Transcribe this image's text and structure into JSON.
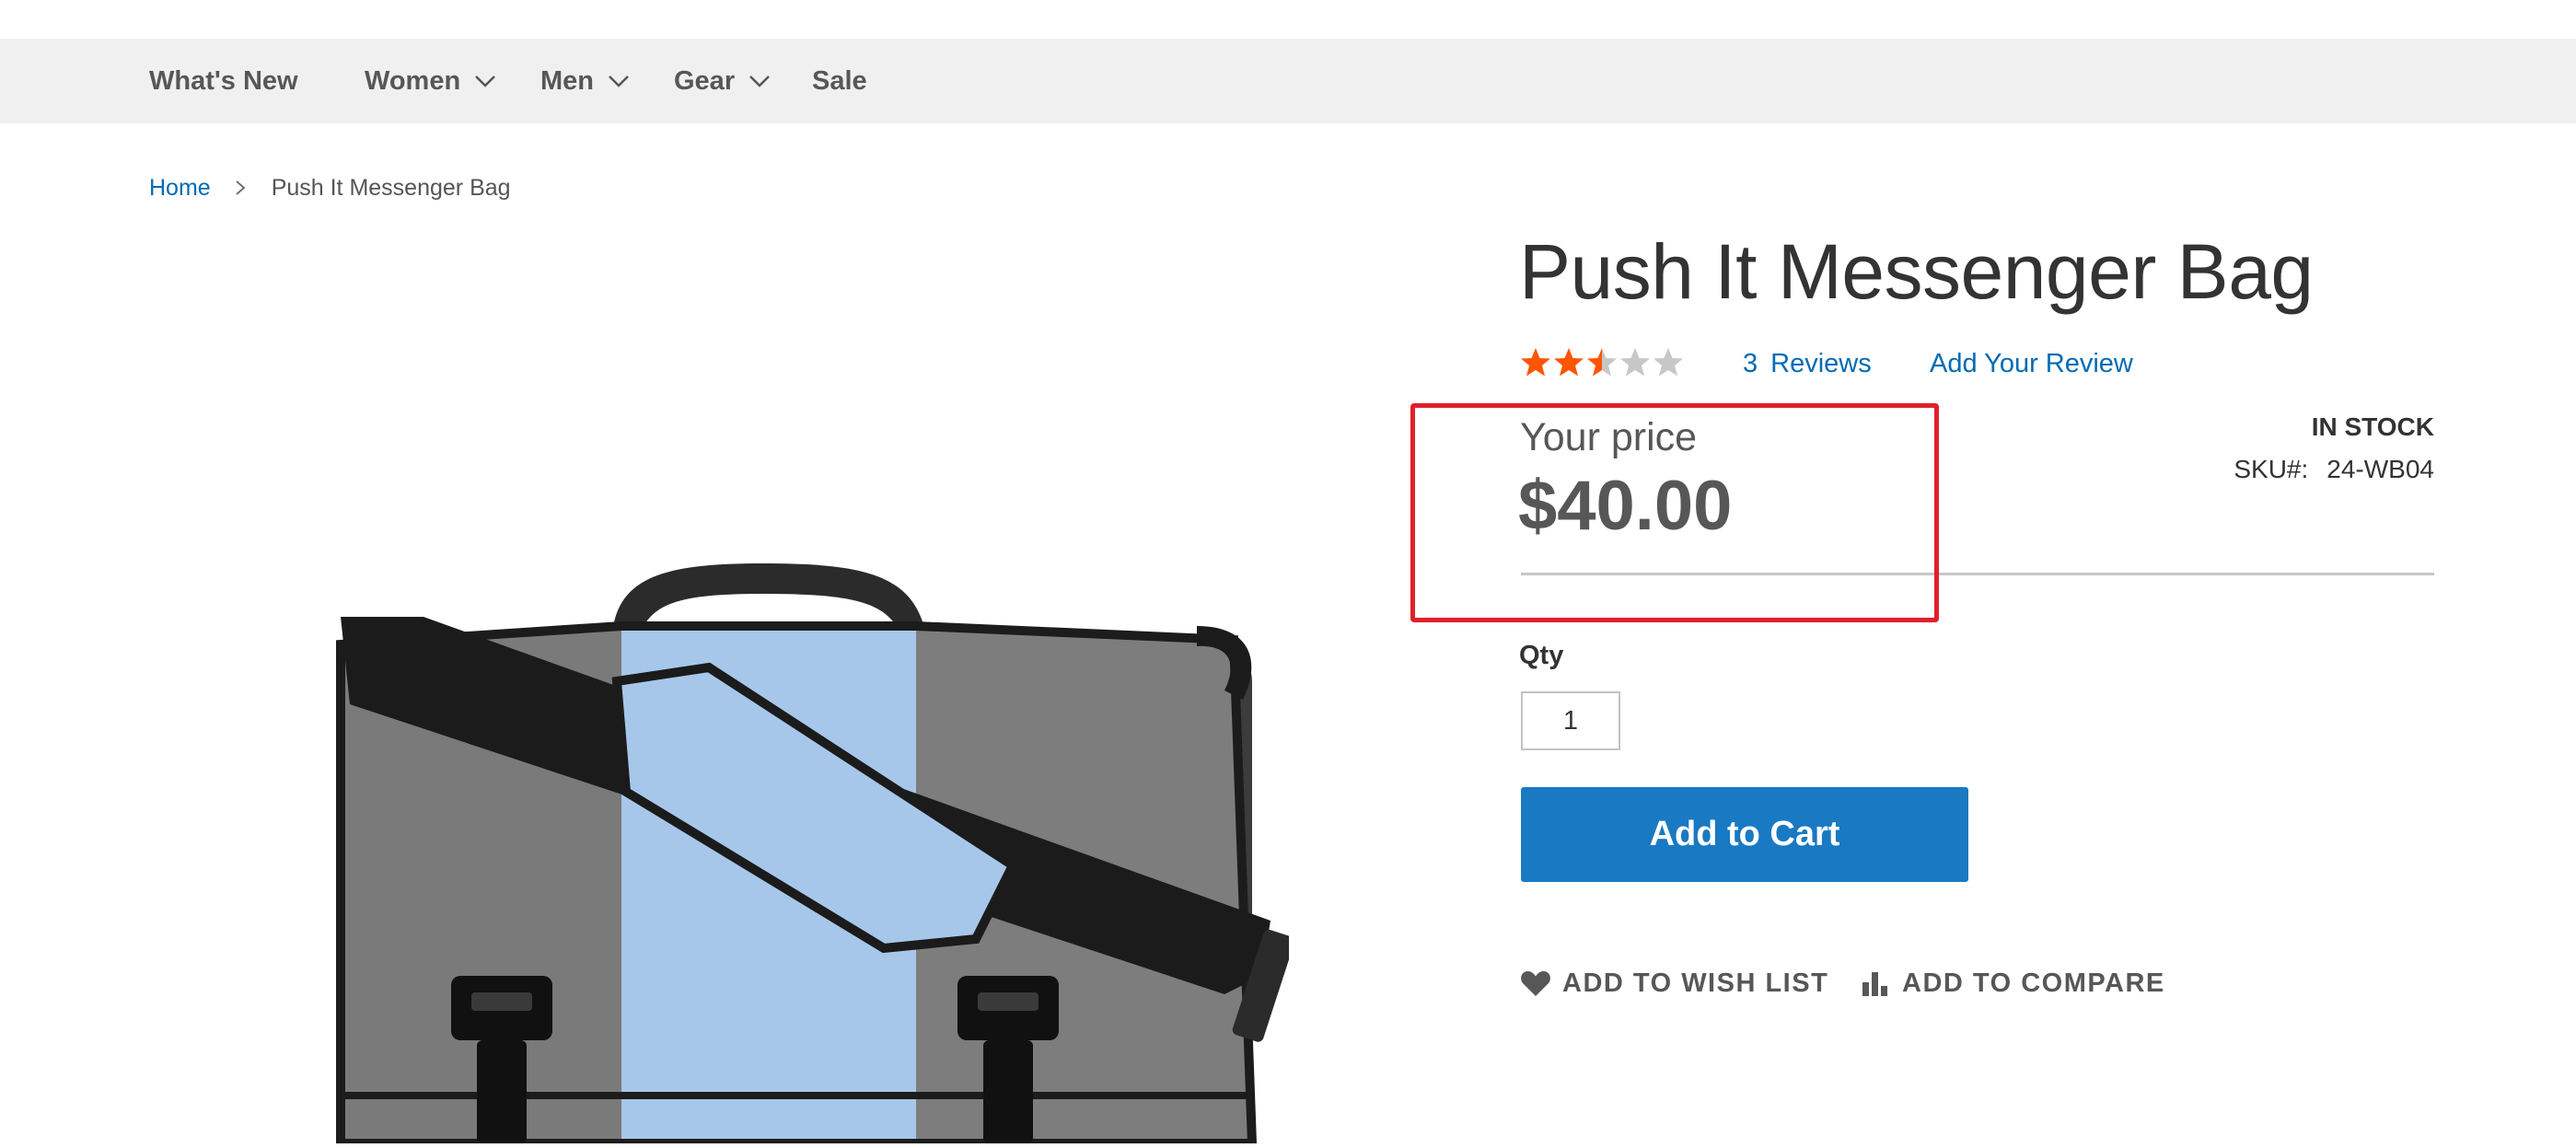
{
  "nav": {
    "items": [
      {
        "label": "What's New",
        "has_dropdown": false
      },
      {
        "label": "Women",
        "has_dropdown": true
      },
      {
        "label": "Men",
        "has_dropdown": true
      },
      {
        "label": "Gear",
        "has_dropdown": true
      },
      {
        "label": "Sale",
        "has_dropdown": false
      }
    ]
  },
  "breadcrumb": {
    "home": "Home",
    "separator_icon": "chevron-right-icon",
    "current": "Push It Messenger Bag"
  },
  "product": {
    "name": "Push It Messenger Bag",
    "rating": {
      "value": 3,
      "max": 5,
      "star_color": "#ff5501",
      "empty_star_color": "#c7c7c7"
    },
    "reviews_count": "3",
    "reviews_label": "Reviews",
    "add_review_label": "Add Your Review",
    "price_label": "Your price",
    "price": "$40.00",
    "stock_status": "IN STOCK",
    "sku_label": "SKU#:",
    "sku": "24-WB04",
    "image_icon": "messenger-bag-image"
  },
  "purchase": {
    "qty_label": "Qty",
    "qty_value": "1",
    "add_to_cart_label": "Add to Cart",
    "button_color": "#1979c3"
  },
  "actions": {
    "wishlist_label": "ADD TO WISH LIST",
    "wishlist_icon": "heart-icon",
    "compare_label": "ADD TO COMPARE",
    "compare_icon": "bar-chart-icon"
  },
  "annotation": {
    "highlight_color": "#e0202a"
  }
}
